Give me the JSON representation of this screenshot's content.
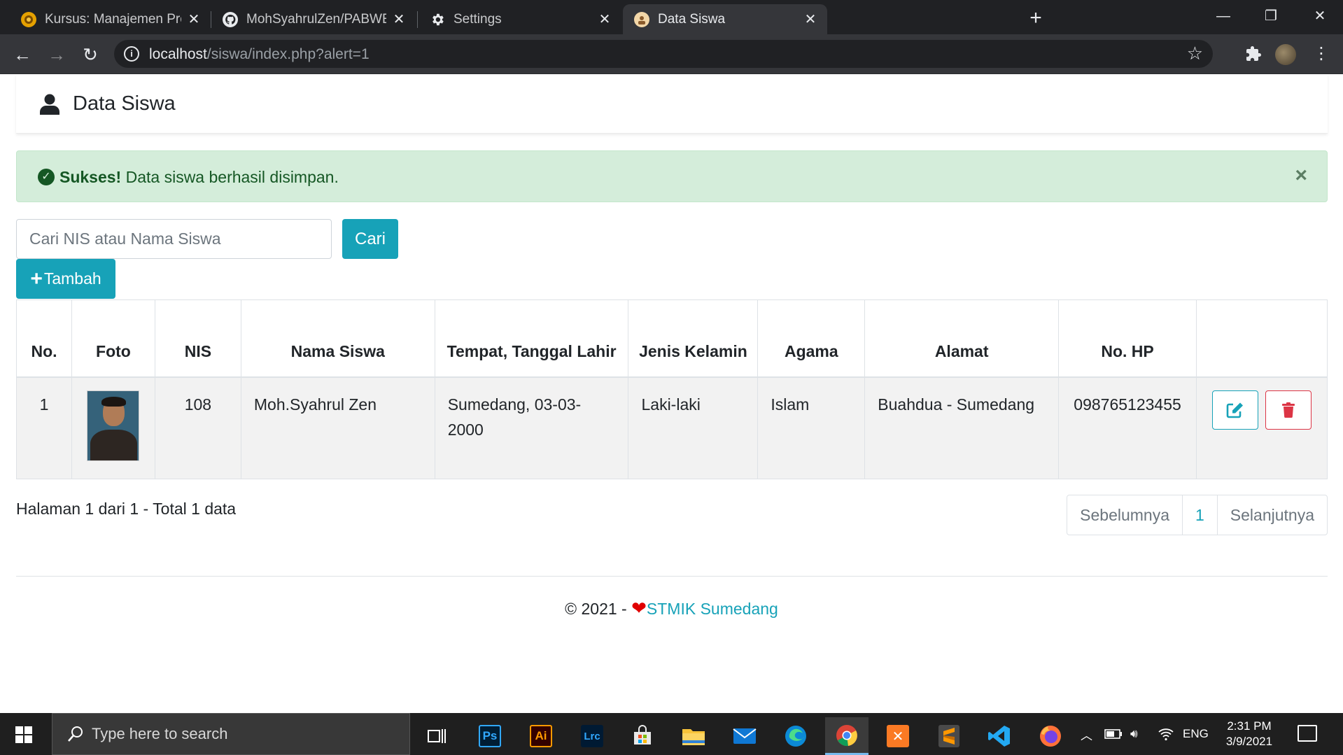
{
  "browser": {
    "tabs": [
      {
        "title": "Kursus: Manajemen Proyek Perangkat Lunak",
        "icon": "university-favicon"
      },
      {
        "title": "MohSyahrulZen/PABWEB-A: Repository",
        "icon": "github-favicon"
      },
      {
        "title": "Settings",
        "icon": "gear-favicon"
      },
      {
        "title": "Data Siswa",
        "icon": "app-favicon"
      }
    ],
    "url_host": "localhost",
    "url_path": "/siswa/index.php?alert=1"
  },
  "page": {
    "header_title": "Data Siswa",
    "alert": {
      "strong": "Sukses!",
      "message": " Data siswa berhasil disimpan.",
      "close": "×",
      "color": "#d4edda"
    },
    "search": {
      "placeholder": "Cari NIS atau Nama Siswa",
      "value": ""
    },
    "search_button": "Cari",
    "add_button": "Tambah",
    "accent_color": "#17a2b8",
    "danger_color": "#dc3545",
    "table": {
      "headers": [
        "No.",
        "Foto",
        "NIS",
        "Nama Siswa",
        "Tempat, Tanggal Lahir",
        "Jenis Kelamin",
        "Agama",
        "Alamat",
        "No. HP",
        ""
      ],
      "rows": [
        {
          "no": "1",
          "nis": "108",
          "nama": "Moh.Syahrul Zen",
          "ttl": "Sumedang, 03-03-2000",
          "jk": "Laki-laki",
          "agama": "Islam",
          "alamat": "Buahdua - Sumedang",
          "hp": "098765123455"
        }
      ]
    },
    "pagination_info": "Halaman 1 dari 1 - Total 1 data",
    "pagination": {
      "prev": "Sebelumnya",
      "current": "1",
      "next": "Selanjutnya"
    },
    "footer": {
      "prefix": "© 2021 - ",
      "link": "STMIK Sumedang"
    }
  },
  "taskbar": {
    "search_placeholder": "Type here to search",
    "apps": [
      "task-view",
      "photoshop",
      "illustrator",
      "lightroom-classic",
      "microsoft-store",
      "file-explorer",
      "mail",
      "edge",
      "chrome",
      "xampp",
      "sublime-text",
      "vscode",
      "firefox"
    ],
    "photoshop_label": "Ps",
    "illustrator_label": "Ai",
    "lightroom_label": "Lrc",
    "language": "ENG",
    "time": "2:31 PM",
    "date": "3/9/2021"
  }
}
